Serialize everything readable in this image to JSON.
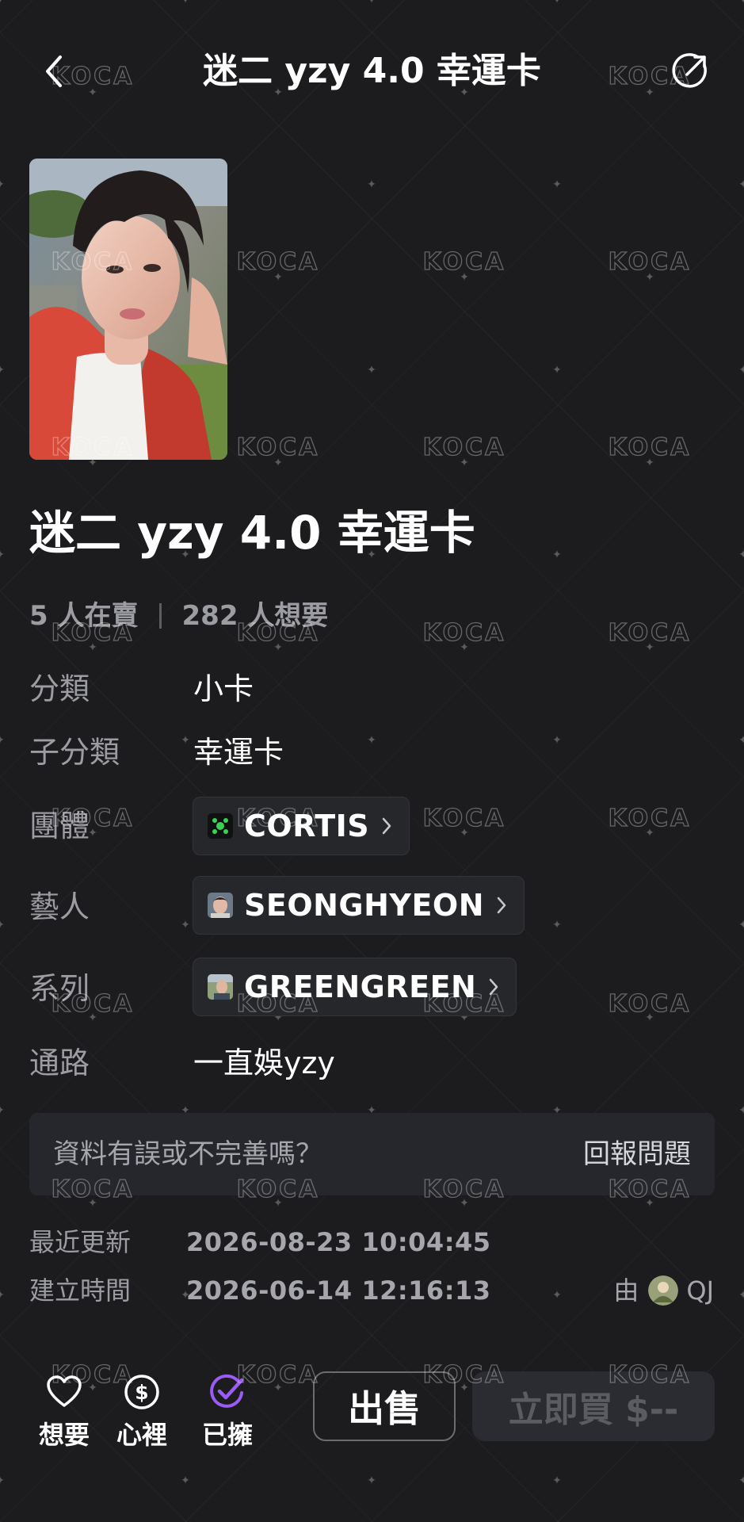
{
  "header": {
    "title": "迷二 yzy 4.0 幸運卡"
  },
  "card": {
    "title": "迷二 yzy 4.0 幸運卡",
    "sellers": "5 人在賣",
    "wanters": "282 人想要"
  },
  "details": {
    "category_label": "分類",
    "category_value": "小卡",
    "subcategory_label": "子分類",
    "subcategory_value": "幸運卡",
    "group_label": "團體",
    "group_value": "CORTIS",
    "artist_label": "藝人",
    "artist_value": "SEONGHYEON",
    "series_label": "系列",
    "series_value": "GREENGREEN",
    "channel_label": "通路",
    "channel_value": "一直娛yzy"
  },
  "report": {
    "question": "資料有誤或不完善嗎？",
    "link": "回報問題"
  },
  "meta": {
    "updated_label": "最近更新",
    "updated_value": "2026-08-23 10:04:45",
    "created_label": "建立時間",
    "created_value": "2026-06-14 12:16:13",
    "creator_prefix": "由",
    "creator_name": "QJ"
  },
  "bottom_bar": {
    "want_label": "想要",
    "wishlist_label": "心裡",
    "owned_label": "已擁",
    "sell_label": "出售",
    "buy_label": "立即買 $--"
  },
  "watermark": {
    "text": "KOCA"
  },
  "icons": {
    "back": "chevron-left-icon",
    "share": "share-external-icon",
    "want": "heart-icon",
    "wishlist": "dollar-circle-icon",
    "owned": "check-circle-icon"
  },
  "colors": {
    "background": "#1c1c1e",
    "owned_accent": "#9b5cf6",
    "group_logo": "#39d353"
  }
}
